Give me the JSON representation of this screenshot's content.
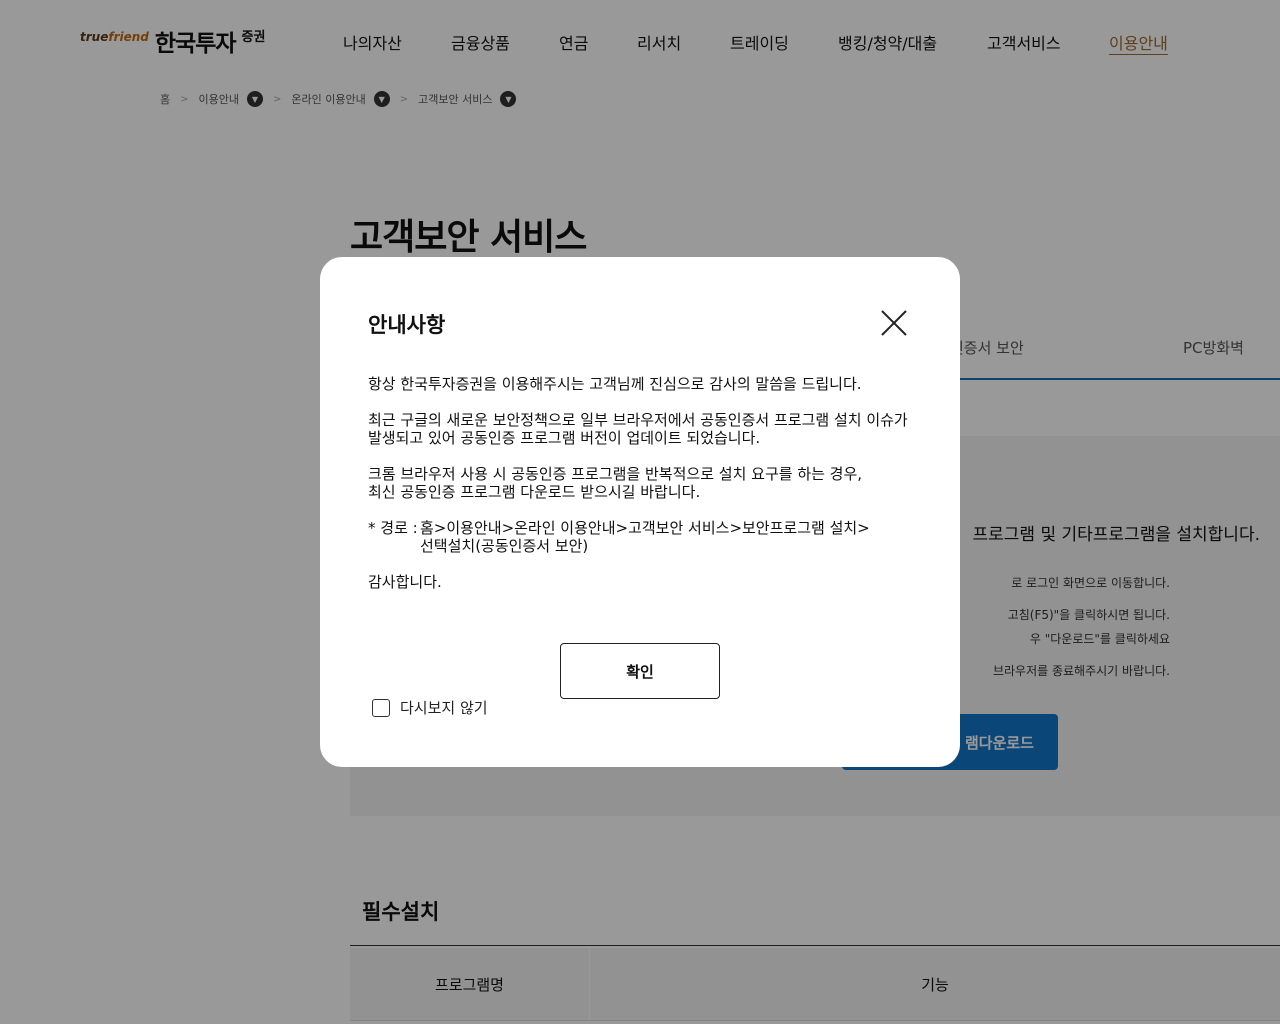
{
  "header": {
    "logo_brand_true": "true",
    "logo_brand_friend": "friend",
    "logo_name": "한국투자",
    "logo_suffix": "증권",
    "nav": [
      "나의자산",
      "금융상품",
      "연금",
      "리서치",
      "트레이딩",
      "뱅킹/청약/대출",
      "고객서비스",
      "이용안내"
    ],
    "active_nav": "이용안내"
  },
  "breadcrumb": {
    "home": "홈",
    "level1": "이용안내",
    "level2": "온라인 이용안내",
    "level3": "고객보안 서비스",
    "separator": ">"
  },
  "page": {
    "title": "고객보안 서비스",
    "tabs": [
      "인증서 보안",
      "PC방화벽"
    ],
    "headline": "프로그램 및 기타프로그램을 설치합니다.",
    "lines": [
      "로 로그인 화면으로 이동합니다.",
      "고침(F5)\"을 클릭하시면 됩니다.",
      "우 \"다운로드\"를 클릭하세요",
      "브라우저를 종료해주시기 바랍니다."
    ],
    "download_button": "램다운로드",
    "section_title": "필수설치",
    "table_headers": [
      "프로그램명",
      "기능"
    ]
  },
  "modal": {
    "title": "안내사항",
    "paragraph1": "항상 한국투자증권을 이용해주시는 고객님께 진심으로 감사의 말씀을 드립니다.",
    "paragraph2": "최근 구글의 새로운 보안정책으로 일부 브라우저에서 공동인증서 프로그램 설치 이슈가\n발생되고 있어 공동인증 프로그램 버전이 업데이트 되었습니다.",
    "paragraph3": "크롬 브라우저 사용 시 공동인증 프로그램을 반복적으로 설치 요구를 하는 경우,\n최신 공동인증 프로그램 다운로드 받으시길 바랍니다.",
    "path_label": "* 경로 :",
    "path_value": "홈>이용안내>온라인 이용안내>고객보안 서비스>보안프로그램 설치>\n선택설치(공동인증서 보안)",
    "closing": "감사합니다.",
    "confirm_label": "확인",
    "no_show_label": "다시보지 않기",
    "no_show_checked": false
  },
  "colors": {
    "accent_blue": "#1275c8",
    "active_nav": "#9c6a2e",
    "overlay": "rgba(0,0,0,0.4)"
  }
}
